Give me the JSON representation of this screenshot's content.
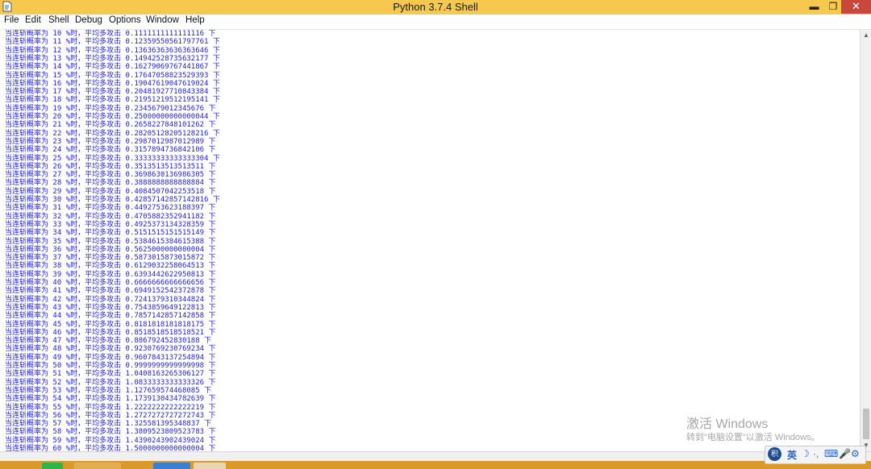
{
  "window": {
    "title": "Python 3.7.4 Shell",
    "controls": {
      "minimize": "▬",
      "maximize": "❐",
      "close": "✕"
    }
  },
  "menu": [
    "File",
    "Edit",
    "Shell",
    "Debug",
    "Options",
    "Window",
    "Help"
  ],
  "output": {
    "prefix": "当连斩概率为",
    "unit": "%时，平均多攻击",
    "suffix": "下",
    "rows": [
      {
        "rate": "10",
        "value": "0.1111111111111116"
      },
      {
        "rate": "11",
        "value": "0.12359550561797761"
      },
      {
        "rate": "12",
        "value": "0.13636363636363646"
      },
      {
        "rate": "13",
        "value": "0.14942528735632177"
      },
      {
        "rate": "14",
        "value": "0.16279069767441867"
      },
      {
        "rate": "15",
        "value": "0.17647058823529393"
      },
      {
        "rate": "16",
        "value": "0.19047619047619024"
      },
      {
        "rate": "17",
        "value": "0.20481927710843384"
      },
      {
        "rate": "18",
        "value": "0.21951219512195141"
      },
      {
        "rate": "19",
        "value": "0.2345679012345676"
      },
      {
        "rate": "20",
        "value": "0.25000000000000044"
      },
      {
        "rate": "21",
        "value": "0.2658227848101262"
      },
      {
        "rate": "22",
        "value": "0.28205128205128216"
      },
      {
        "rate": "23",
        "value": "0.2987012987012989"
      },
      {
        "rate": "24",
        "value": "0.3157894736842106"
      },
      {
        "rate": "25",
        "value": "0.33333333333333304"
      },
      {
        "rate": "26",
        "value": "0.3513513513513511"
      },
      {
        "rate": "27",
        "value": "0.3698630136986305"
      },
      {
        "rate": "28",
        "value": "0.3888888888888884"
      },
      {
        "rate": "29",
        "value": "0.4084507042253518"
      },
      {
        "rate": "30",
        "value": "0.42857142857142816"
      },
      {
        "rate": "31",
        "value": "0.4492753623188397"
      },
      {
        "rate": "32",
        "value": "0.4705882352941182"
      },
      {
        "rate": "33",
        "value": "0.4925373134328359"
      },
      {
        "rate": "34",
        "value": "0.5151515151515149"
      },
      {
        "rate": "35",
        "value": "0.5384615384615388"
      },
      {
        "rate": "36",
        "value": "0.5625000000000004"
      },
      {
        "rate": "37",
        "value": "0.5873015873015872"
      },
      {
        "rate": "38",
        "value": "0.6129032258064513"
      },
      {
        "rate": "39",
        "value": "0.6393442622950813"
      },
      {
        "rate": "40",
        "value": "0.6666666666666656"
      },
      {
        "rate": "41",
        "value": "0.6949152542372878"
      },
      {
        "rate": "42",
        "value": "0.7241379310344824"
      },
      {
        "rate": "43",
        "value": "0.7543859649122813"
      },
      {
        "rate": "44",
        "value": "0.7857142857142858"
      },
      {
        "rate": "45",
        "value": "0.8181818181818175"
      },
      {
        "rate": "46",
        "value": "0.8518518518518521"
      },
      {
        "rate": "47",
        "value": "0.886792452830188"
      },
      {
        "rate": "48",
        "value": "0.9230769230769234"
      },
      {
        "rate": "49",
        "value": "0.9607843137254894"
      },
      {
        "rate": "50",
        "value": "0.9999999999999998"
      },
      {
        "rate": "51",
        "value": "1.0408163265306127"
      },
      {
        "rate": "52",
        "value": "1.0833333333333326"
      },
      {
        "rate": "53",
        "value": "1.127659574468085"
      },
      {
        "rate": "54",
        "value": "1.1739130434782639"
      },
      {
        "rate": "55",
        "value": "1.2222222222222219"
      },
      {
        "rate": "56",
        "value": "1.2727272727272743"
      },
      {
        "rate": "57",
        "value": "1.325581395348837"
      },
      {
        "rate": "58",
        "value": "1.3809523809523783"
      },
      {
        "rate": "59",
        "value": "1.4390243902439024"
      },
      {
        "rate": "60",
        "value": "1.5000000000000004"
      }
    ]
  },
  "watermark": {
    "title": "激活 Windows",
    "subtitle": "转到\"电脑设置\"以激活 Windows。"
  },
  "tray": {
    "logo": "积",
    "ime": "英"
  },
  "colors": {
    "titlebar": "#f6c84e",
    "output_text": "#1f1fd0",
    "close_button": "#c9473b",
    "taskbar": "#d99a2b"
  }
}
